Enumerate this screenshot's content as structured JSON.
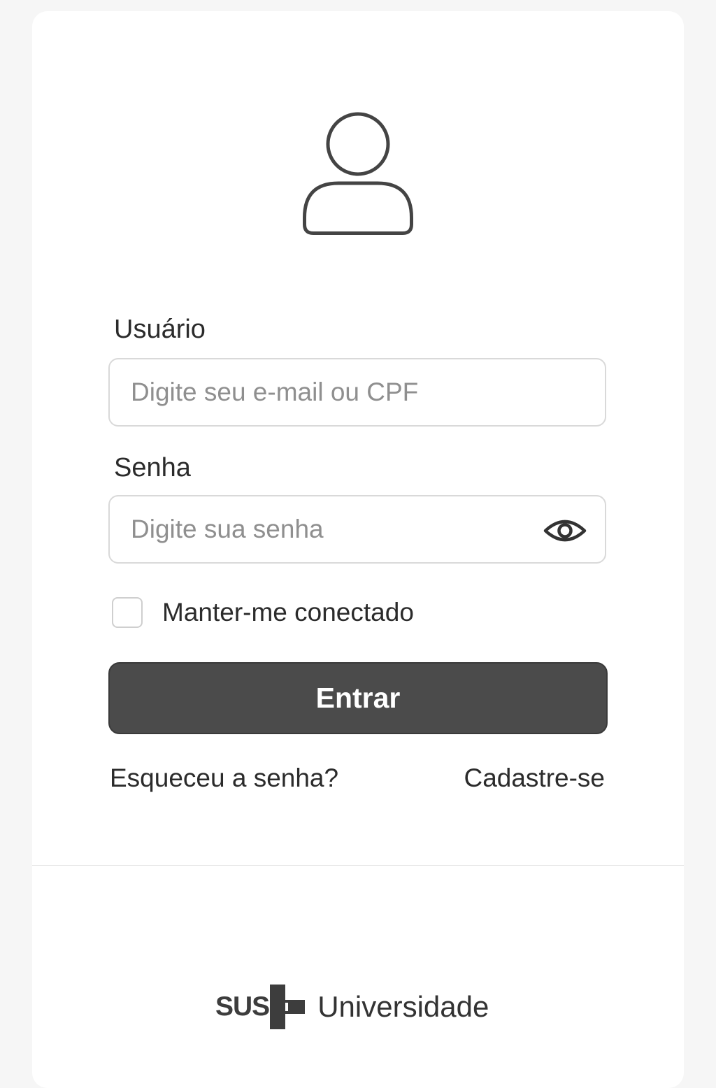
{
  "login": {
    "avatar_icon": "user-icon",
    "username": {
      "label": "Usuário",
      "placeholder": "Digite seu e-mail ou CPF",
      "value": ""
    },
    "password": {
      "label": "Senha",
      "placeholder": "Digite sua senha",
      "value": "",
      "toggle_icon": "eye-icon"
    },
    "remember": {
      "label": "Manter-me conectado",
      "checked": false
    },
    "submit_label": "Entrar",
    "forgot_label": "Esqueceu a senha?",
    "signup_label": "Cadastre-se"
  },
  "footer": {
    "logo_mark": "SUS",
    "logo_text": "Universidade"
  },
  "colors": {
    "page_bg": "#f6f6f6",
    "card_bg": "#ffffff",
    "button_bg": "#4b4b4b",
    "text": "#2b2b2b",
    "placeholder": "#8f8f8f",
    "border": "#d9d9d9"
  }
}
